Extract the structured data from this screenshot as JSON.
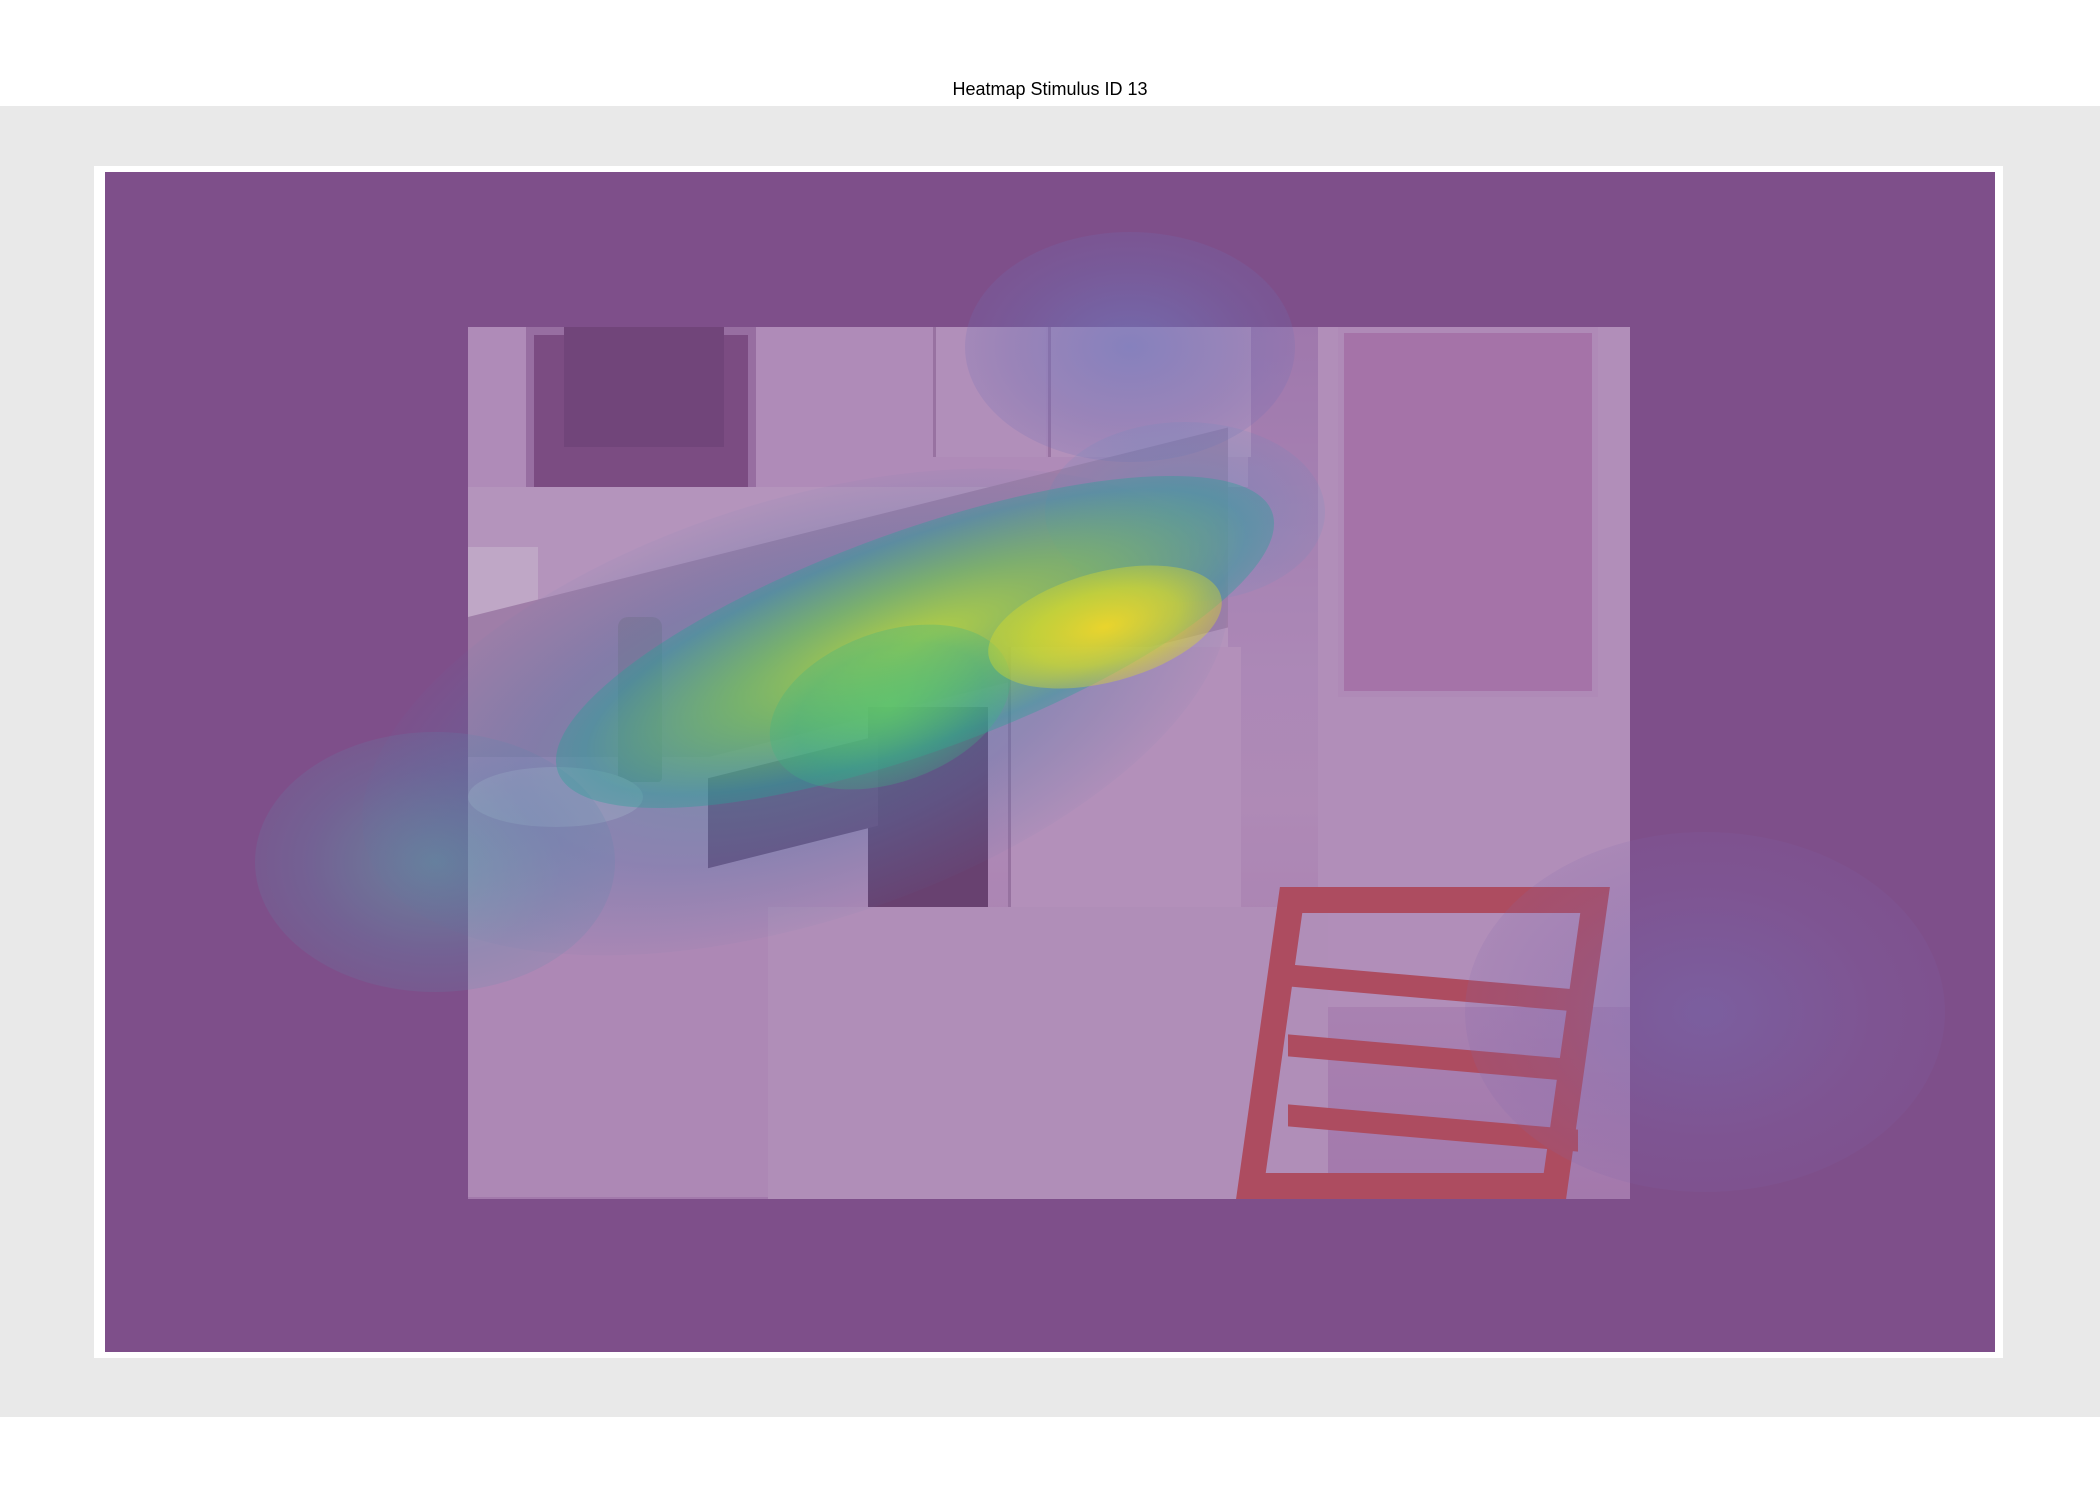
{
  "header": {
    "title": "Heatmap Stimulus ID 13"
  },
  "stimulus": {
    "scene": "kitchen",
    "background_color": "#7e4f8a",
    "page_background_color": "#e9e9e9",
    "frame_color": "#ffffff"
  }
}
